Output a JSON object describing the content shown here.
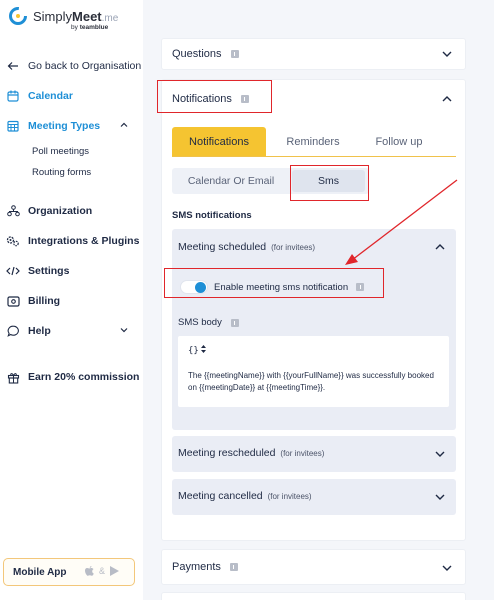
{
  "brand": {
    "name_light": "Simply",
    "name_bold": "Meet",
    "suffix": ".me",
    "by": "by",
    "by_brand": "teamblue",
    "accent": "#1e8fd6"
  },
  "sidebar": {
    "back": "Go back to Organisation",
    "calendar": "Calendar",
    "meeting_types": "Meeting Types",
    "poll_meetings": "Poll meetings",
    "routing_forms": "Routing forms",
    "organization": "Organization",
    "integrations": "Integrations & Plugins",
    "settings": "Settings",
    "billing": "Billing",
    "help": "Help",
    "earn": "Earn 20% commission",
    "mobile_app": "Mobile App",
    "mobile_sep": "&"
  },
  "main": {
    "questions": "Questions",
    "notifications": "Notifications",
    "tabs": [
      "Notifications",
      "Reminders",
      "Follow up"
    ],
    "channels": [
      "Calendar Or Email",
      "Sms"
    ],
    "sms_notifications": "SMS notifications",
    "scheduled": {
      "title": "Meeting scheduled",
      "note": "(for invitees)"
    },
    "toggle_label": "Enable meeting sms notification",
    "toggle_on": true,
    "sms_body_label": "SMS body",
    "vars_button": "{}",
    "sms_body_text": "The {{meetingName}} with {{yourFullName}} was successfully booked on {{meetingDate}} at {{meetingTime}}.",
    "rescheduled": {
      "title": "Meeting rescheduled",
      "note": "(for invitees)"
    },
    "cancelled": {
      "title": "Meeting cancelled",
      "note": "(for invitees)"
    },
    "payments": "Payments"
  },
  "colors": {
    "tab_active": "#f5c431",
    "annotation": "#e0262b"
  }
}
